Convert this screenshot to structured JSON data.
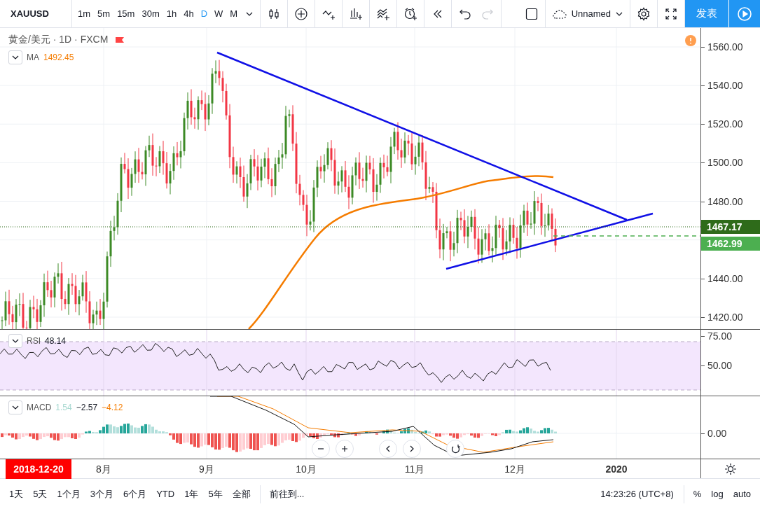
{
  "toolbar": {
    "symbol": "XAUUSD",
    "intervals": [
      {
        "label": "1m",
        "selected": false
      },
      {
        "label": "5m",
        "selected": false
      },
      {
        "label": "15m",
        "selected": false
      },
      {
        "label": "30m",
        "selected": false
      },
      {
        "label": "1h",
        "selected": false
      },
      {
        "label": "4h",
        "selected": false
      },
      {
        "label": "D",
        "selected": true
      },
      {
        "label": "W",
        "selected": false
      },
      {
        "label": "M",
        "selected": false
      }
    ],
    "redo_disabled": true,
    "layout_name": "Unnamed",
    "publish_button": "发表"
  },
  "chart": {
    "legend": {
      "title": "黄金/美元 · 1D · FXCM"
    },
    "ma": {
      "name": "MA",
      "values": [
        {
          "text": "1492.45",
          "color": "#f57c00"
        }
      ]
    },
    "price_axis": {
      "labels": [
        "1560.00",
        "1540.00",
        "1520.00",
        "1500.00",
        "1480.00",
        "1440.00",
        "1420.00"
      ],
      "tags": [
        {
          "text": "1467.17",
          "kind": "last"
        },
        {
          "text": "1462.99",
          "kind": "line"
        }
      ]
    },
    "rsi": {
      "name": "RSI",
      "values": [
        {
          "text": "48.14",
          "color": "#131722"
        }
      ],
      "axis": [
        "75.00",
        "50.00"
      ]
    },
    "macd": {
      "name": "MACD",
      "values": [
        {
          "text": "1.54",
          "color": "#a7d8d0"
        },
        {
          "text": "−2.57",
          "color": "#131722"
        },
        {
          "text": "−4.12",
          "color": "#f57c00"
        }
      ],
      "axis": [
        "0.00"
      ]
    },
    "time_axis": {
      "cursor_date": "2018-12-20",
      "labels": [
        {
          "text": "8月",
          "kind": "month"
        },
        {
          "text": "9月",
          "kind": "month"
        },
        {
          "text": "10月",
          "kind": "month"
        },
        {
          "text": "11月",
          "kind": "month"
        },
        {
          "text": "12月",
          "kind": "month"
        },
        {
          "text": "2020",
          "kind": "year"
        }
      ]
    }
  },
  "bottom_bar": {
    "ranges": [
      "1天",
      "5天",
      "1个月",
      "3个月",
      "6个月",
      "YTD",
      "1年",
      "5年",
      "全部"
    ],
    "goto": "前往到...",
    "clock": "14:23:26 (UTC+8)",
    "scale_options": [
      "%",
      "log",
      "auto"
    ]
  }
}
